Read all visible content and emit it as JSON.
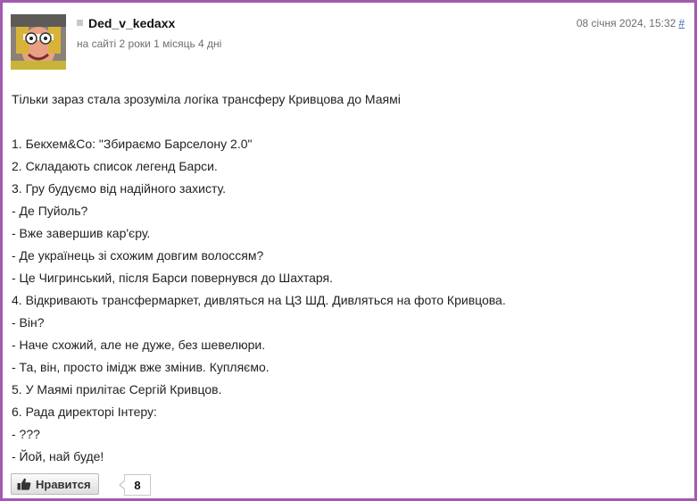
{
  "post": {
    "author": {
      "username": "Ded_v_kedaxx",
      "member_since": "на сайті 2 роки 1 місяць 4 дні",
      "avatar_icon": "user-avatar-photo"
    },
    "date": "08 січня 2024, 15:32",
    "permalink": "#",
    "body_lines": [
      "Тільки зараз стала зрозуміла логіка трансферу Кривцова до Маямі",
      "",
      "1. Бекхем&Co: \"Збираємо Барселону 2.0\"",
      "2. Складають список легенд Барси.",
      "3. Гру будуємо від надійного захисту.",
      "- Де Пуйоль?",
      "- Вже завершив кар'єру.",
      "- Де українець зі схожим довгим волоссям?",
      "- Це Чигринський, після Барси повернувся до Шахтаря.",
      "4. Відкривають трансфермаркет, дивляться на ЦЗ ШД. Дивляться на фото Кривцова.",
      "- Він?",
      "- Наче схожий, але не дуже, без шевелюри.",
      "- Та, він, просто імідж вже змінив. Купляємо.",
      "5. У Маямі прилітає Сергій Кривцов.",
      "6. Рада директорі Інтеру:",
      "- ???",
      "- Йой, най буде!"
    ]
  },
  "like": {
    "label": "Нравится",
    "count": "8",
    "icon": "thumbs-up-icon"
  },
  "colors": {
    "frame_border": "#a15ab0",
    "link": "#3b6fb6",
    "meta_text": "#6e6e6e"
  }
}
